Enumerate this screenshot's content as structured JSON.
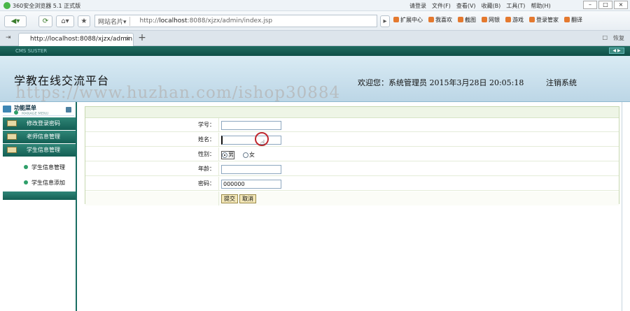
{
  "browser": {
    "app_title": "360安全浏览器 5.1 正式版",
    "login_label": "请登录",
    "menus": [
      "文件(F)",
      "查看(V)",
      "收藏(B)",
      "工具(T)",
      "帮助(H)"
    ],
    "window_controls": [
      "–",
      "□",
      "×"
    ],
    "site_name_label": "网站名片",
    "address_url_prefix": "http://",
    "address_url_host": "localhost",
    "address_url_rest": ":8088/xjzx/admin/index.jsp",
    "toolbar_items": [
      "扩展中心",
      "我喜欢",
      "截图",
      "网银",
      "游戏",
      "登录管家",
      "翻译"
    ],
    "tab_title": "http://localhost:8088/xjzx/admin...",
    "tab_close": "×",
    "new_tab": "+",
    "tab_right_items": [
      "□",
      "恢复"
    ]
  },
  "app": {
    "strip_text": "CMS SUSTER",
    "title": "学教在线交流平台",
    "welcome_text": "欢迎您：系统管理员      2015年3月28日  20:05:18",
    "logout_label": "注销系统",
    "watermark": "https://www.huzhan.com/ishop30884"
  },
  "sidebar": {
    "menu_title": "功能菜单",
    "menu_subtitle": "MANAGE MENU",
    "items": [
      {
        "label": "修改登录密码"
      },
      {
        "label": "老师信息管理"
      },
      {
        "label": "学生信息管理"
      }
    ],
    "subitems": [
      {
        "label": "学生信息管理"
      },
      {
        "label": "学生信息添加"
      }
    ]
  },
  "form": {
    "student_id_label": "学号：",
    "student_id_value": "",
    "name_label": "姓名：",
    "name_value": "",
    "gender_label": "性别：",
    "gender_options": [
      "男",
      "女"
    ],
    "gender_selected": "男",
    "age_label": "年龄：",
    "age_value": "",
    "password_label": "密码：",
    "password_value": "000000",
    "submit_label": "提交",
    "cancel_label": "取消"
  },
  "colors": {
    "header_bg": "#c6dde9",
    "sidebar_menu_bg": "#1f6f63",
    "form_border": "#c7d8b0",
    "cursor_ring": "#c0282f"
  }
}
